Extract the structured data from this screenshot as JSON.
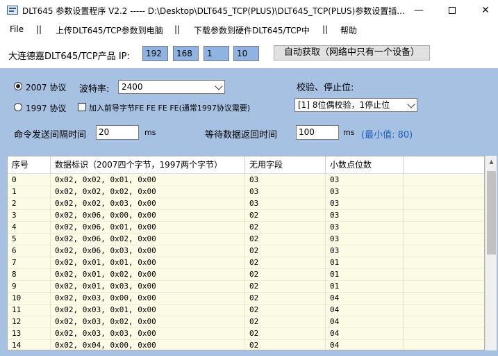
{
  "window": {
    "title": "DLT645 参数设置程序 V2.2 ----- D:\\Desktop\\DLT645_TCP(PLUS)\\DLT645_TCP(PLUS)参数设置插...",
    "min_glyph": "—",
    "close_glyph": "✕"
  },
  "menu": {
    "items": [
      "File",
      "||",
      "上传DLT645/TCP参数到电脑",
      "||",
      "下载参数到硬件DLT645/TCP中",
      "||",
      "帮助"
    ]
  },
  "ip": {
    "label": "大连德嘉DLT645/TCP产品 IP:",
    "octets": [
      "192",
      "168",
      "1",
      "10"
    ],
    "auto_button": "自动获取（网络中只有一个设备）"
  },
  "settings": {
    "protocol_2007": "2007 协议",
    "protocol_1997": "1997 协议",
    "baud_label": "波特率:",
    "baud_value": "2400",
    "prefix_checkbox_label": "加入前导字节FE FE FE FE(通常1997协议需要)",
    "parity_label": "校验、停止位:",
    "parity_value": "[1] 8位偶校验，1停止位",
    "interval_label": "命令发送间隔时间",
    "interval_value": "20",
    "interval_unit": "ms",
    "wait_label": "等待数据返回时间",
    "wait_value": "100",
    "wait_unit": "ms",
    "wait_min_note": "(最小值: 80)",
    "accent_color": "#1f5fbf"
  },
  "table": {
    "columns": [
      "序号",
      "数据标识（2007四个字节，1997两个字节）",
      "无用字段",
      "小数点位数"
    ],
    "rows": [
      [
        "0",
        "0x02,  0x02,  0x01,  0x00",
        "03",
        "03"
      ],
      [
        "1",
        "0x02,  0x02,  0x02,  0x00",
        "03",
        "03"
      ],
      [
        "2",
        "0x02,  0x02,  0x03,  0x00",
        "03",
        "03"
      ],
      [
        "3",
        "0x02,  0x06,  0x00,  0x00",
        "02",
        "03"
      ],
      [
        "4",
        "0x02,  0x06,  0x01,  0x00",
        "02",
        "03"
      ],
      [
        "5",
        "0x02,  0x06,  0x02,  0x00",
        "02",
        "03"
      ],
      [
        "6",
        "0x02,  0x06,  0x03,  0x00",
        "02",
        "03"
      ],
      [
        "7",
        "0x02,  0x01,  0x01,  0x00",
        "02",
        "01"
      ],
      [
        "8",
        "0x02,  0x01,  0x02,  0x00",
        "02",
        "01"
      ],
      [
        "9",
        "0x02,  0x01,  0x03,  0x00",
        "02",
        "01"
      ],
      [
        "10",
        "0x02,  0x03,  0x00,  0x00",
        "02",
        "04"
      ],
      [
        "11",
        "0x02,  0x03,  0x01,  0x00",
        "02",
        "04"
      ],
      [
        "12",
        "0x02,  0x03,  0x02,  0x00",
        "02",
        "04"
      ],
      [
        "13",
        "0x02,  0x03,  0x03,  0x00",
        "02",
        "04"
      ],
      [
        "14",
        "0x02,  0x04,  0x00,  0x00",
        "02",
        "04"
      ]
    ]
  }
}
